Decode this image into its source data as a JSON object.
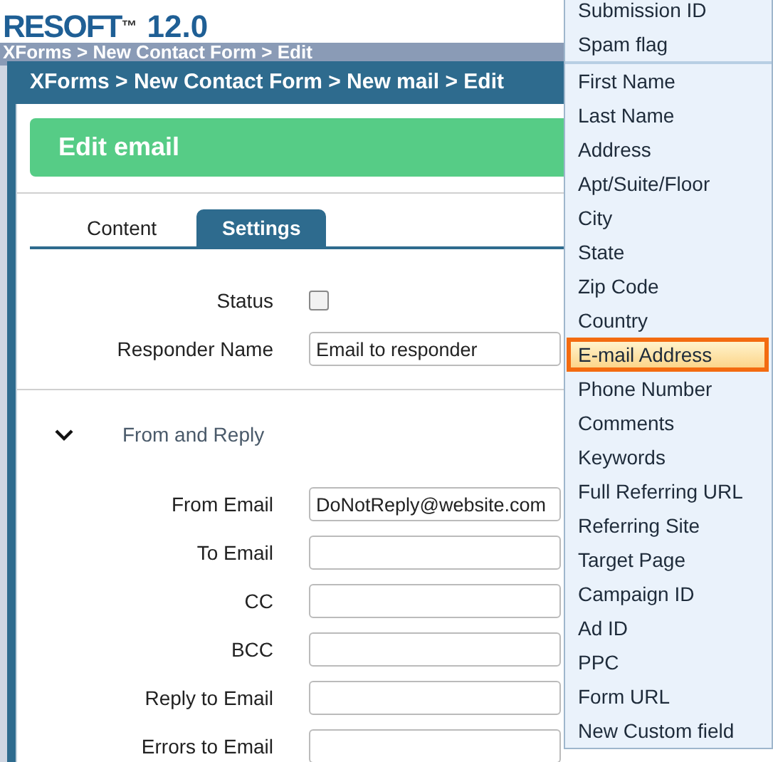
{
  "app": {
    "logo": "RESOFT",
    "logo_mark": "™",
    "version": "12.0",
    "breadcrumb": "XForms > New Contact Form > Edit"
  },
  "dialog": {
    "title": "XForms > New Contact Form > New mail > Edit",
    "banner": "Edit email",
    "tabs": [
      {
        "label": "Content",
        "selected": false
      },
      {
        "label": "Settings",
        "selected": true
      }
    ],
    "settings": [
      {
        "kind": "checkbox",
        "label": "Status",
        "checked": false
      },
      {
        "kind": "text",
        "label": "Responder Name",
        "value": "Email to responder"
      }
    ],
    "section": {
      "title": "From and Reply",
      "expanded": true,
      "fields": [
        {
          "label": "From Email",
          "value": "DoNotReply@website.com"
        },
        {
          "label": "To Email"
        },
        {
          "label": "CC"
        },
        {
          "label": "BCC"
        },
        {
          "label": "Reply to Email"
        },
        {
          "label": "Errors to Email"
        }
      ]
    }
  },
  "dropdown": {
    "groups": [
      [
        {
          "label": "Submission ID",
          "selected": false
        },
        {
          "label": "Spam flag",
          "selected": false
        }
      ],
      [
        {
          "label": "First Name",
          "selected": false
        },
        {
          "label": "Last Name",
          "selected": false
        },
        {
          "label": "Address",
          "selected": false
        },
        {
          "label": "Apt/Suite/Floor",
          "selected": false
        },
        {
          "label": "City",
          "selected": false
        },
        {
          "label": "State",
          "selected": false
        },
        {
          "label": "Zip Code",
          "selected": false
        },
        {
          "label": "Country",
          "selected": false
        },
        {
          "label": "E-mail Address",
          "selected": true
        },
        {
          "label": "Phone Number",
          "selected": false
        },
        {
          "label": "Comments",
          "selected": false
        },
        {
          "label": "Keywords",
          "selected": false
        },
        {
          "label": "Full Referring URL",
          "selected": false
        },
        {
          "label": "Referring Site",
          "selected": false
        },
        {
          "label": "Target Page",
          "selected": false
        },
        {
          "label": "Campaign ID",
          "selected": false
        },
        {
          "label": "Ad ID",
          "selected": false
        },
        {
          "label": "PPC",
          "selected": false
        },
        {
          "label": "Form URL",
          "selected": false
        },
        {
          "label": "New Custom field",
          "selected": false
        }
      ]
    ]
  }
}
